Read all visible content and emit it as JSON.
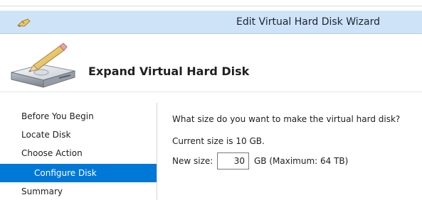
{
  "window": {
    "title": "Edit Virtual Hard Disk Wizard",
    "title_icon": "pencil-icon"
  },
  "header": {
    "title": "Expand Virtual Hard Disk",
    "icon": "disk-pencil-icon"
  },
  "sidebar": {
    "items": [
      {
        "label": "Before You Begin",
        "active": false
      },
      {
        "label": "Locate Disk",
        "active": false
      },
      {
        "label": "Choose Action",
        "active": false
      },
      {
        "label": "Configure Disk",
        "active": true
      },
      {
        "label": "Summary",
        "active": false
      }
    ]
  },
  "content": {
    "question": "What size do you want to make the virtual hard disk?",
    "current_size": "Current size is 10 GB.",
    "new_size_label": "New size:",
    "new_size_value": "30",
    "unit_hint": "GB (Maximum: 64 TB)"
  },
  "colors": {
    "title_bar": "#cfe3f8",
    "active_item": "#0078d7",
    "text": "#1e1e1e"
  }
}
